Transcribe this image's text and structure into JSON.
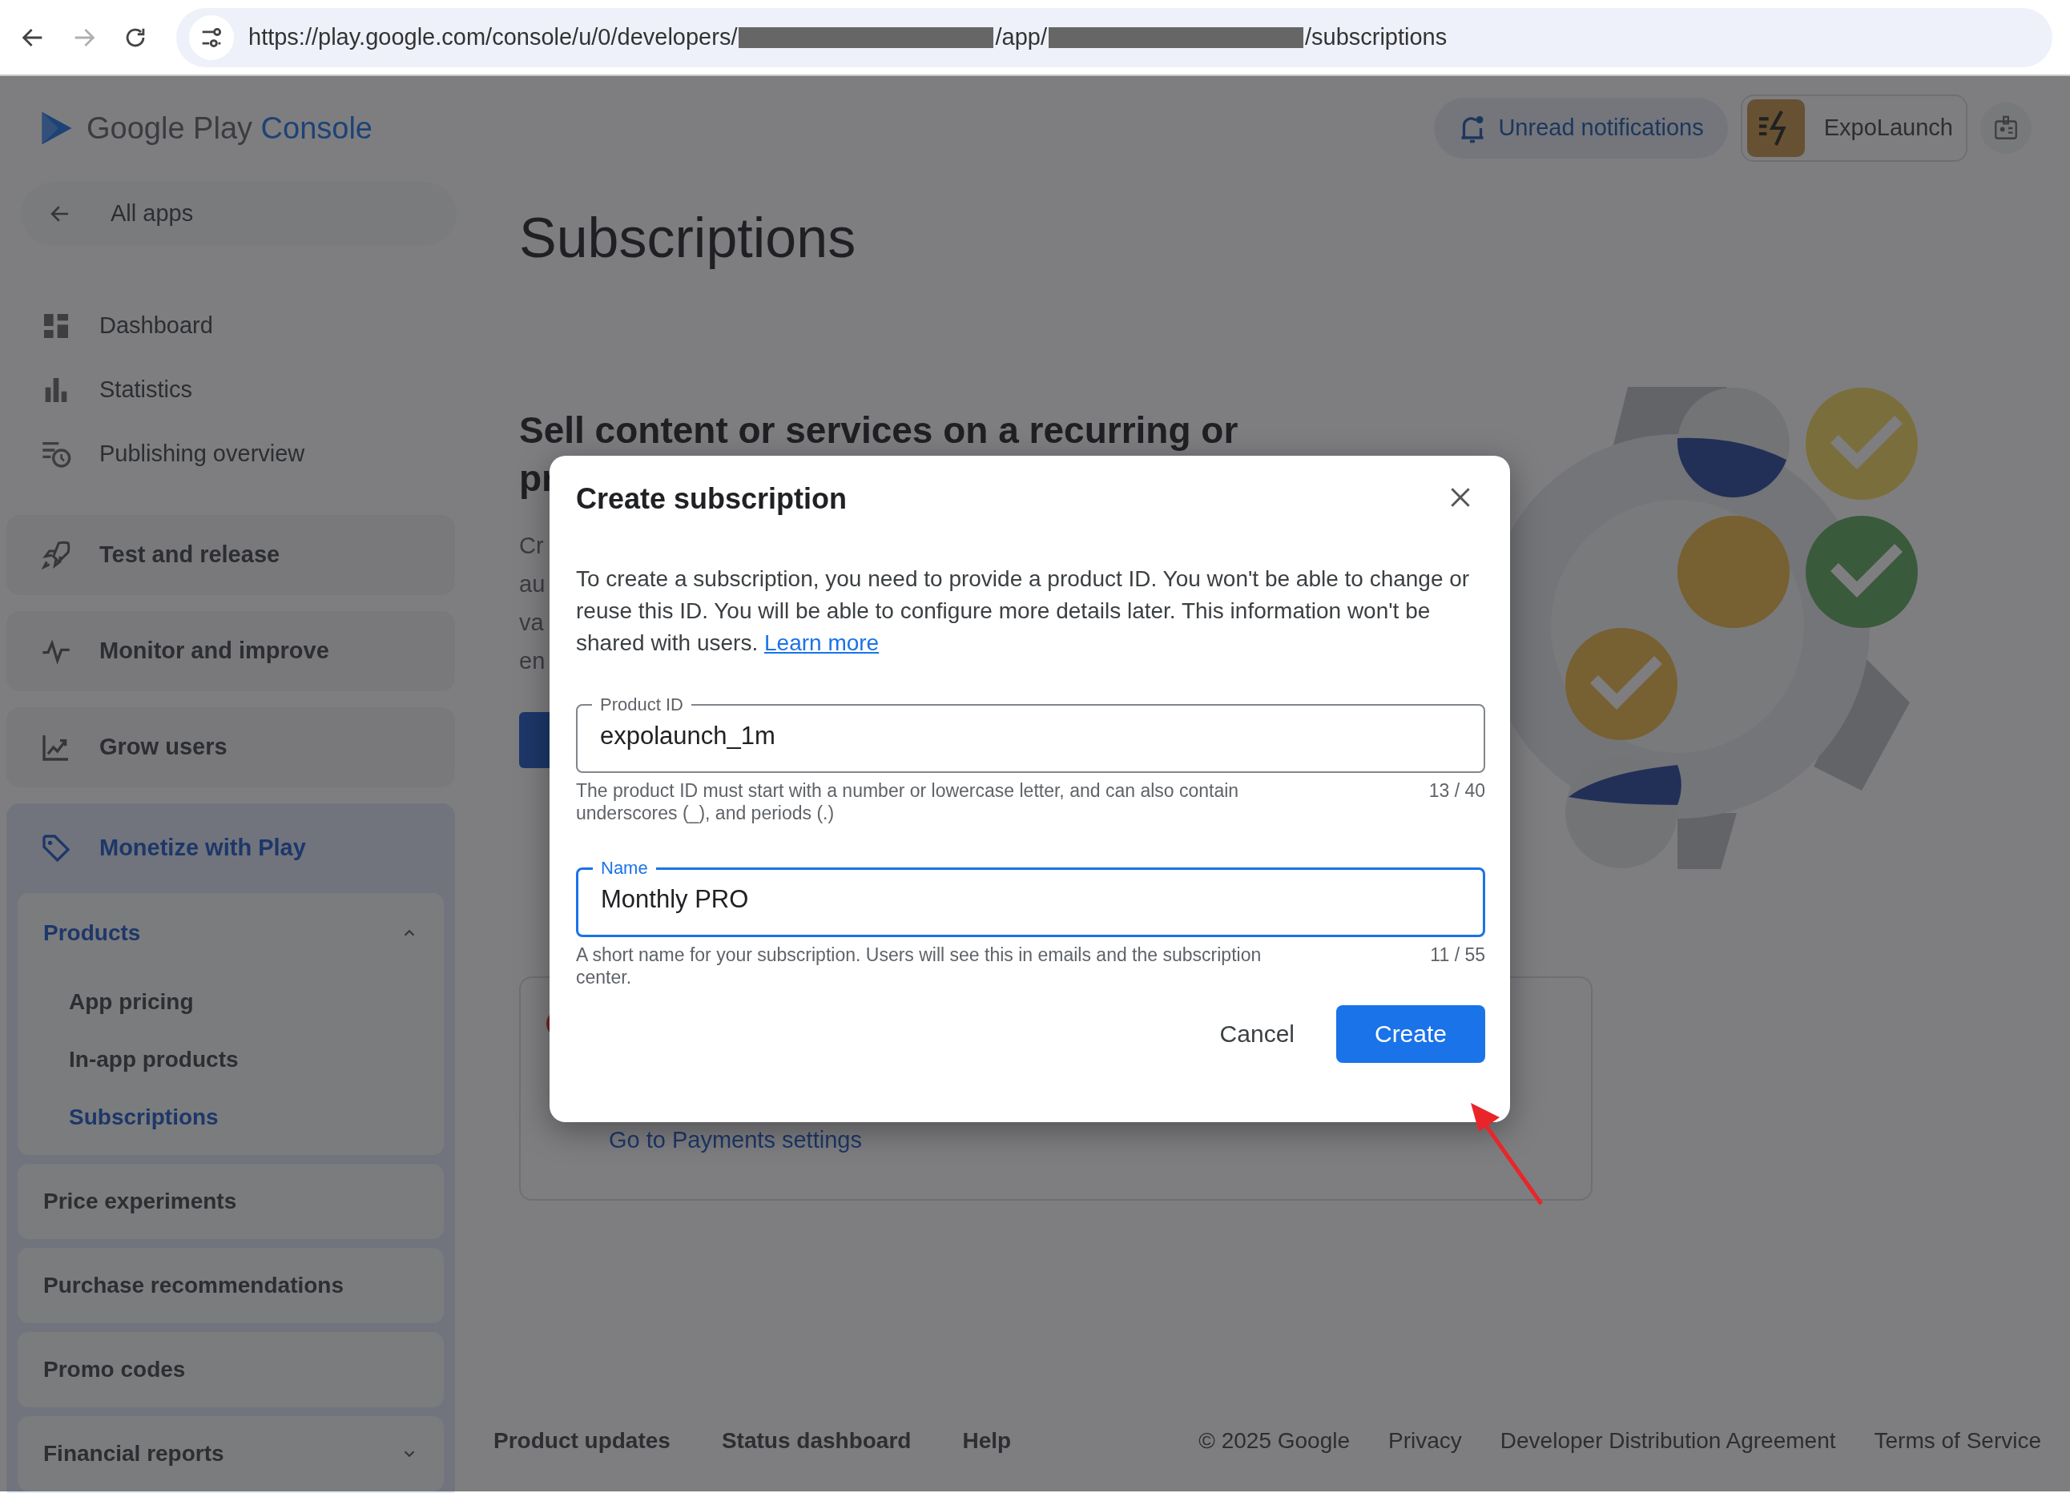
{
  "browser": {
    "forward_disabled": true,
    "url_parts": [
      {
        "kind": "text",
        "text": "https://play.google.com/console/u/0/developers/"
      },
      {
        "kind": "redacted"
      },
      {
        "kind": "text",
        "text": "/app/"
      },
      {
        "kind": "redacted"
      },
      {
        "kind": "text",
        "text": "/subscriptions"
      }
    ]
  },
  "header": {
    "logo_text": "Google Play",
    "logo_accent": "Console",
    "notifications": "Unread notifications",
    "account": "ExpoLaunch"
  },
  "sidebar": {
    "back": "All apps",
    "links": [
      "Dashboard",
      "Statistics",
      "Publishing overview"
    ],
    "sections": [
      {
        "label": "Test and release",
        "selected": false
      },
      {
        "label": "Monitor and improve",
        "selected": false
      },
      {
        "label": "Grow users",
        "selected": false
      },
      {
        "label": "Monetize with Play",
        "selected": true,
        "groups": [
          {
            "kind": "expandable",
            "label": "Products",
            "expanded": true,
            "children": [
              {
                "label": "App pricing",
                "selected": false
              },
              {
                "label": "In-app products",
                "selected": false
              },
              {
                "label": "Subscriptions",
                "selected": true
              }
            ]
          },
          {
            "kind": "link",
            "label": "Price experiments"
          },
          {
            "kind": "link",
            "label": "Purchase recommendations"
          },
          {
            "kind": "link",
            "label": "Promo codes"
          },
          {
            "kind": "expandable",
            "label": "Financial reports",
            "expanded": false
          }
        ]
      }
    ]
  },
  "page": {
    "title": "Subscriptions",
    "heading_lines": [
      "Sell content or services on a recurring or",
      "pr"
    ],
    "paragraph_fragments": [
      "Cr",
      "au",
      "va",
      "en"
    ],
    "card_link": "Go to Payments settings"
  },
  "dialog": {
    "title": "Create subscription",
    "body": "To create a subscription, you need to provide a product ID. You won't be able to change or reuse this ID. You will be able to configure more details later. This information won't be shared with users.",
    "link": "Learn more",
    "fields": [
      {
        "label": "Product ID",
        "value": "expolaunch_1m",
        "helper": "The product ID must start with a number or lowercase letter, and can also contain underscores (_), and periods (.)",
        "counter": "13 / 40",
        "focused": false
      },
      {
        "label": "Name",
        "value": "Monthly PRO",
        "helper": "A short name for your subscription. Users will see this in emails and the subscription center.",
        "counter": "11 / 55",
        "focused": true
      }
    ],
    "buttons": [
      {
        "kind": "text",
        "label": "Cancel"
      },
      {
        "kind": "primary",
        "label": "Create"
      }
    ]
  },
  "footer": {
    "left": [
      "Product updates",
      "Status dashboard",
      "Help"
    ],
    "right": [
      "© 2025 Google",
      "Privacy",
      "Developer Distribution Agreement",
      "Terms of Service"
    ]
  }
}
